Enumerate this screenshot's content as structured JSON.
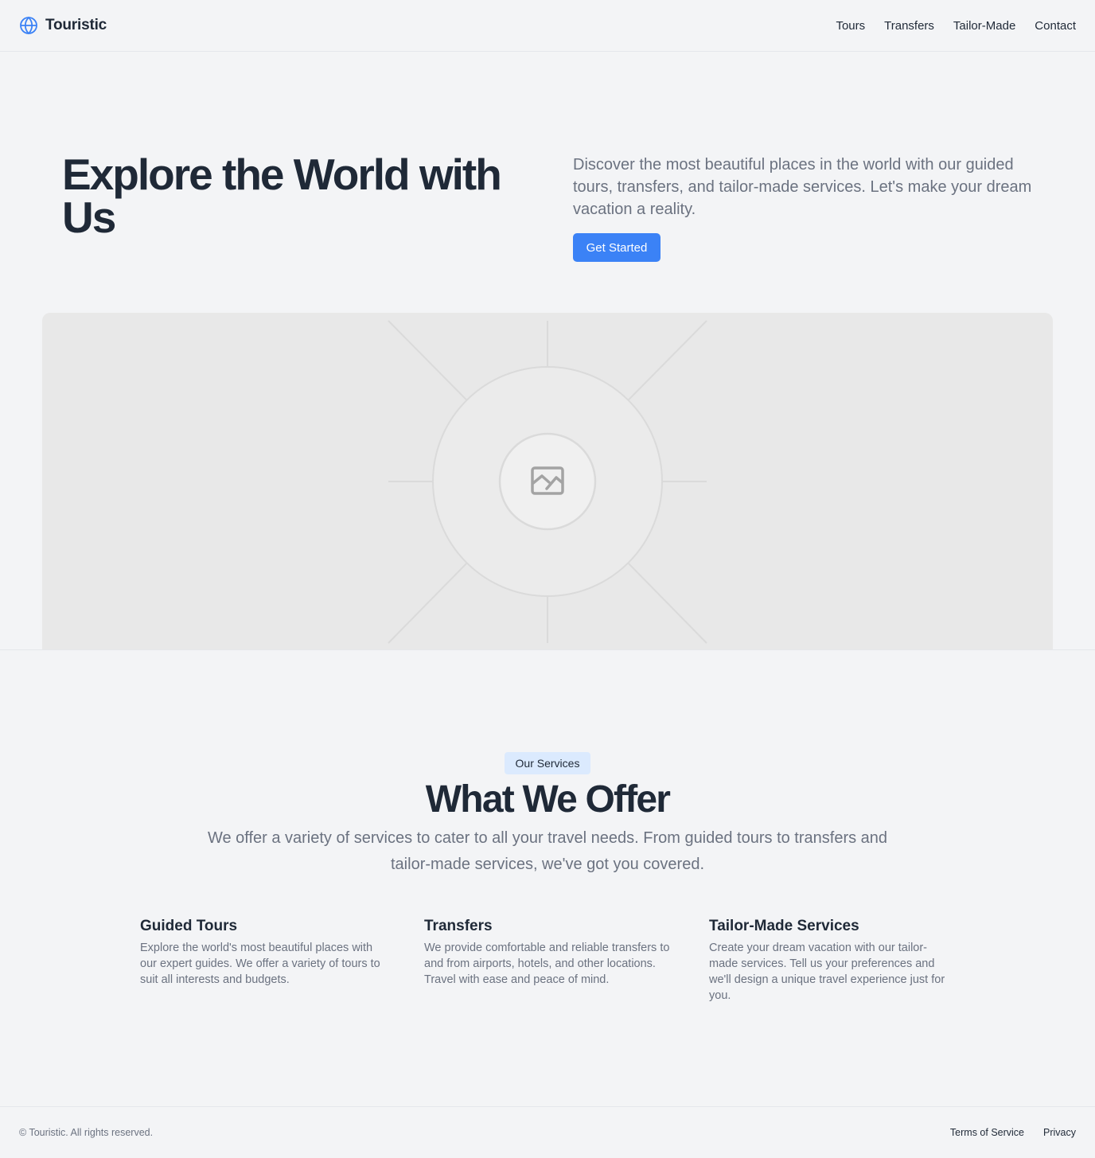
{
  "header": {
    "brand": "Touristic",
    "brand_icon": "globe-icon",
    "accent": "#3b82f6",
    "nav": [
      {
        "label": "Tours"
      },
      {
        "label": "Transfers"
      },
      {
        "label": "Tailor-Made"
      },
      {
        "label": "Contact"
      }
    ]
  },
  "hero": {
    "title": "Explore the World with Us",
    "description": "Discover the most beautiful places in the world with our guided tours, transfers, and tailor-made services. Let's make your dream vacation a reality.",
    "cta": "Get Started",
    "image_icon": "image-placeholder-icon"
  },
  "services": {
    "badge": "Our Services",
    "title": "What We Offer",
    "description": "We offer a variety of services to cater to all your travel needs. From guided tours to transfers and tailor-made services, we've got you covered.",
    "items": [
      {
        "title": "Guided Tours",
        "text": "Explore the world's most beautiful places with our expert guides. We offer a variety of tours to suit all interests and budgets."
      },
      {
        "title": "Transfers",
        "text": "We provide comfortable and reliable transfers to and from airports, hotels, and other locations. Travel with ease and peace of mind."
      },
      {
        "title": "Tailor-Made Services",
        "text": "Create your dream vacation with our tailor-made services. Tell us your preferences and we'll design a unique travel experience just for you."
      }
    ]
  },
  "footer": {
    "copyright": "© Touristic. All rights reserved.",
    "links": [
      {
        "label": "Terms of Service"
      },
      {
        "label": "Privacy"
      }
    ]
  }
}
